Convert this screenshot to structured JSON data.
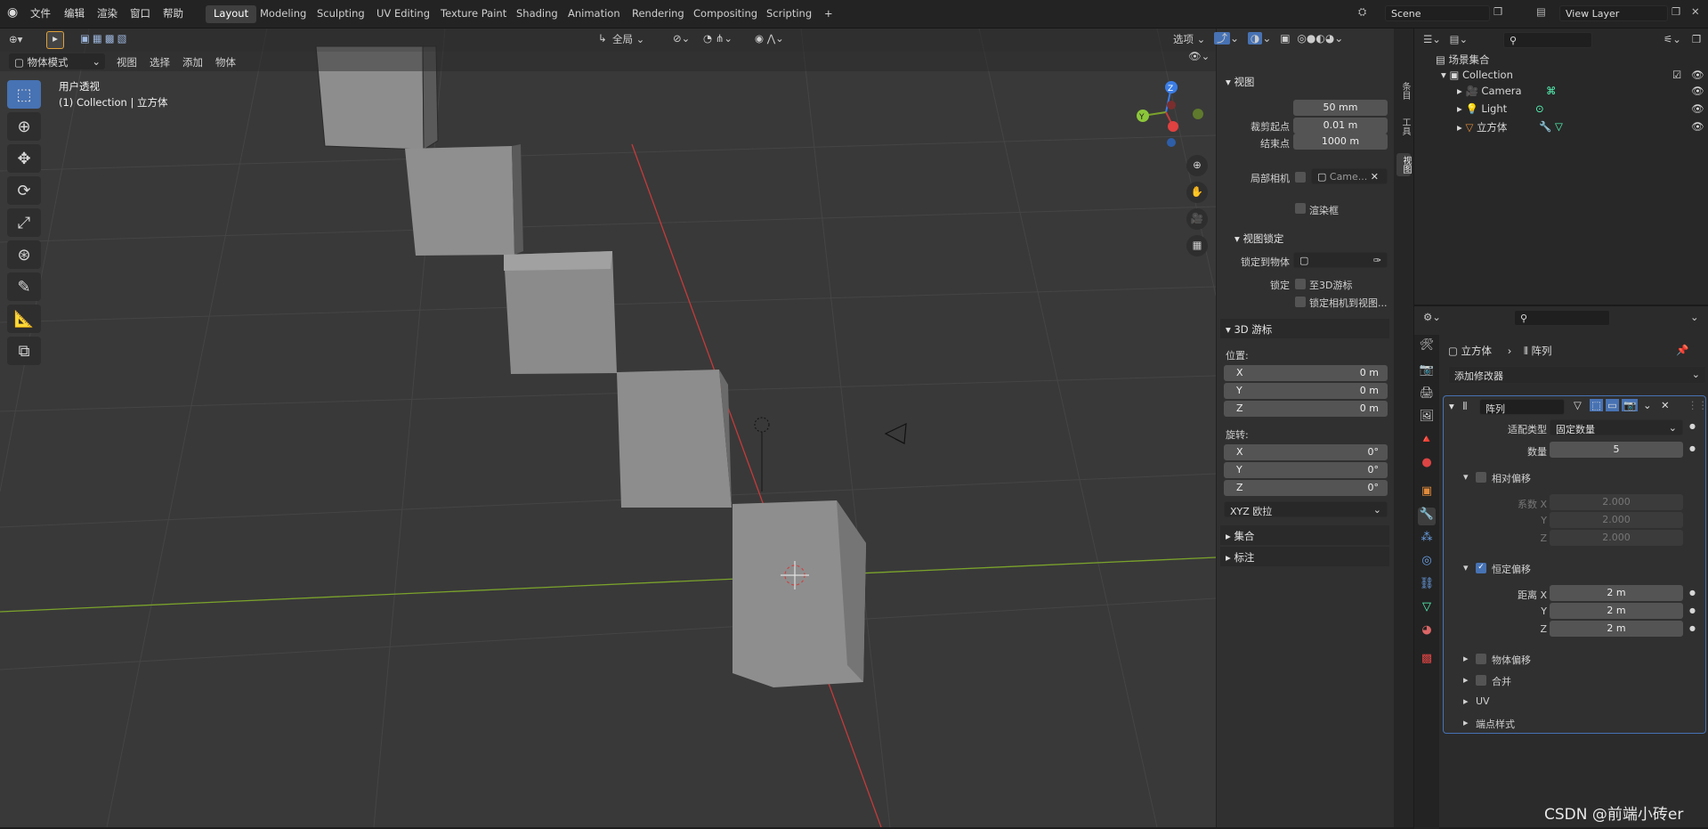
{
  "topbar": {
    "menus": [
      "文件",
      "编辑",
      "渲染",
      "窗口",
      "帮助"
    ],
    "workspaces": [
      "Layout",
      "Modeling",
      "Sculpting",
      "UV Editing",
      "Texture Paint",
      "Shading",
      "Animation",
      "Rendering",
      "Compositing",
      "Scripting"
    ],
    "active_workspace": "Layout",
    "add_tab": "+",
    "scene": "Scene",
    "view_layer": "View Layer"
  },
  "viewport": {
    "header": {
      "mode": "物体模式",
      "menus": [
        "视图",
        "选择",
        "添加",
        "物体"
      ],
      "orientation": "全局",
      "options": "选项"
    },
    "overlay_title": "用户透视",
    "overlay_subtitle": "(1) Collection | 立方体",
    "tools": [
      "select-box-icon",
      "cursor-icon",
      "move-icon",
      "rotate-icon",
      "scale-icon",
      "transform-icon",
      "annotate-icon",
      "measure-icon",
      "add-cube-icon"
    ],
    "gizmo": {
      "x": "X",
      "y": "Y",
      "z": "Z"
    }
  },
  "npanel": {
    "view": {
      "title": "视图",
      "focal_label": "焦距",
      "focal_value": "50 mm",
      "clip_start_label": "裁剪起点",
      "clip_start_value": "0.01 m",
      "clip_end_label": "结束点",
      "clip_end_value": "1000 m",
      "local_camera_label": "局部相机",
      "local_camera_value": "Came...",
      "render_region": "渲染框"
    },
    "view_lock": {
      "title": "视图锁定",
      "lock_to_object": "锁定到物体",
      "lock_label": "锁定",
      "to_3d_cursor": "至3D游标",
      "lock_camera": "锁定相机到视图..."
    },
    "cursor3d": {
      "title": "3D 游标",
      "location_label": "位置:",
      "x_label": "X",
      "x": "0 m",
      "y_label": "Y",
      "y": "0 m",
      "z_label": "Z",
      "z": "0 m",
      "rotation_label": "旋转:",
      "rx": "0°",
      "ry": "0°",
      "rz": "0°",
      "rotation_mode": "XYZ 欧拉"
    },
    "collection": "集合",
    "annotation": "标注",
    "side_tabs": [
      "条目",
      "工具",
      "视图"
    ]
  },
  "outliner": {
    "root": "场景集合",
    "collection": "Collection",
    "items": [
      "Camera",
      "Light",
      "立方体"
    ]
  },
  "properties": {
    "object_name": "立方体",
    "modifier_label": "阵列",
    "add_modifier": "添加修改器",
    "modifier": {
      "name": "阵列",
      "fit_type_label": "适配类型",
      "fit_type": "固定数量",
      "count_label": "数量",
      "count": "5",
      "relative_offset": "相对偏移",
      "factor_x_label": "系数 X",
      "factor_x": "2.000",
      "factor_y_label": "Y",
      "factor_y": "2.000",
      "factor_z_label": "Z",
      "factor_z": "2.000",
      "constant_offset": "恒定偏移",
      "dist_x_label": "距离 X",
      "dist_x": "2 m",
      "dist_y_label": "Y",
      "dist_y": "2 m",
      "dist_z_label": "Z",
      "dist_z": "2 m",
      "object_offset": "物体偏移",
      "merge": "合并",
      "uv": "UV",
      "caps": "端点样式"
    }
  },
  "watermark": "CSDN @前端小砖er",
  "colors": {
    "accent": "#4772b3",
    "x_axis": "#c63a3a",
    "y_axis": "#7ba32b",
    "viewport": "#393939"
  }
}
